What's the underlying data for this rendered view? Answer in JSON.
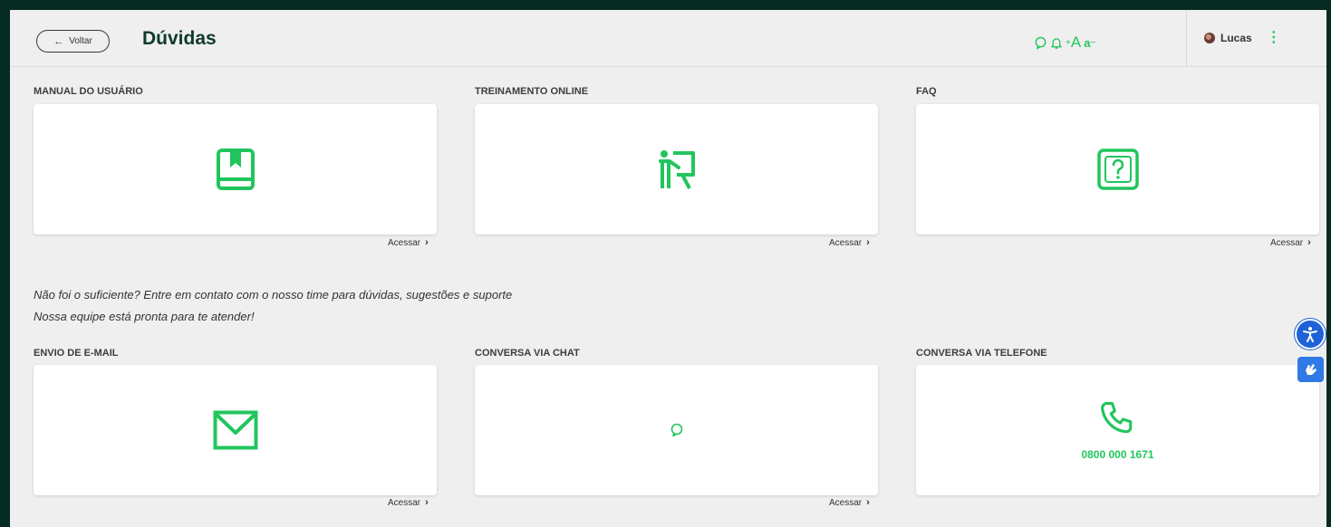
{
  "header": {
    "back_label": "Voltar",
    "title": "Dúvidas",
    "user_name": "Lucas",
    "tools": {
      "increase_font": "A",
      "decrease_font": "a"
    }
  },
  "sections": {
    "manual": {
      "title": "MANUAL DO USUÁRIO",
      "link": "Acessar",
      "icon": "book-icon"
    },
    "treinamento": {
      "title": "TREINAMENTO ONLINE",
      "link": "Acessar",
      "icon": "teacher-board-icon"
    },
    "faq": {
      "title": "FAQ",
      "link": "Acessar",
      "icon": "question-box-icon"
    },
    "email": {
      "title": "ENVIO DE E-MAIL",
      "link": "Acessar",
      "icon": "mail-icon"
    },
    "chat": {
      "title": "CONVERSA VIA CHAT",
      "link": "Acessar",
      "icon": "chat-bubble-icon"
    },
    "telefone": {
      "title": "CONVERSA VIA TELEFONE",
      "phone": "0800 000 1671",
      "icon": "phone-icon"
    }
  },
  "contact_message": {
    "line1": "Não foi o suficiente? Entre em contato com o nosso time para dúvidas, sugestões e suporte",
    "line2": "Nossa equipe está pronta para te atender!"
  },
  "colors": {
    "accent": "#21c55d",
    "title": "#0d3b2e",
    "background": "#efefef",
    "frame": "#062b23",
    "a11y": "#1f62d8"
  }
}
